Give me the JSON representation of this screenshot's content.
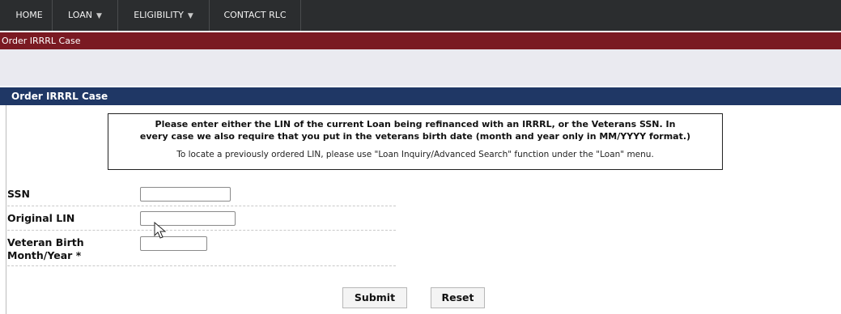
{
  "nav": {
    "items": [
      {
        "label": "HOME",
        "has_caret": false
      },
      {
        "label": "LOAN",
        "has_caret": true
      },
      {
        "label": "ELIGIBILITY",
        "has_caret": true
      },
      {
        "label": "CONTACT RLC",
        "has_caret": false
      }
    ]
  },
  "breadcrumb": "Order IRRRL Case",
  "section_title": "Order IRRRL Case",
  "instructions": {
    "line1": "Please enter either the LIN of the current Loan being refinanced with an IRRRL, or the Veterans SSN. In",
    "line2": "every case we also require that you put in the veterans birth date (month and year only in MM/YYYY format.)",
    "note": "To locate a previously ordered LIN, please use \"Loan Inquiry/Advanced Search\" function under the \"Loan\" menu."
  },
  "form": {
    "ssn_label": "SSN",
    "ssn_value": "",
    "lin_label": "Original LIN",
    "lin_value": "",
    "birth_label_line1": "Veteran Birth",
    "birth_label_line2": "Month/Year *",
    "birth_value": ""
  },
  "buttons": {
    "submit": "Submit",
    "reset": "Reset"
  },
  "colors": {
    "navbar": "#2b2d2f",
    "breadcrumb_bar": "#7a1a22",
    "section_bar": "#1f3765"
  }
}
